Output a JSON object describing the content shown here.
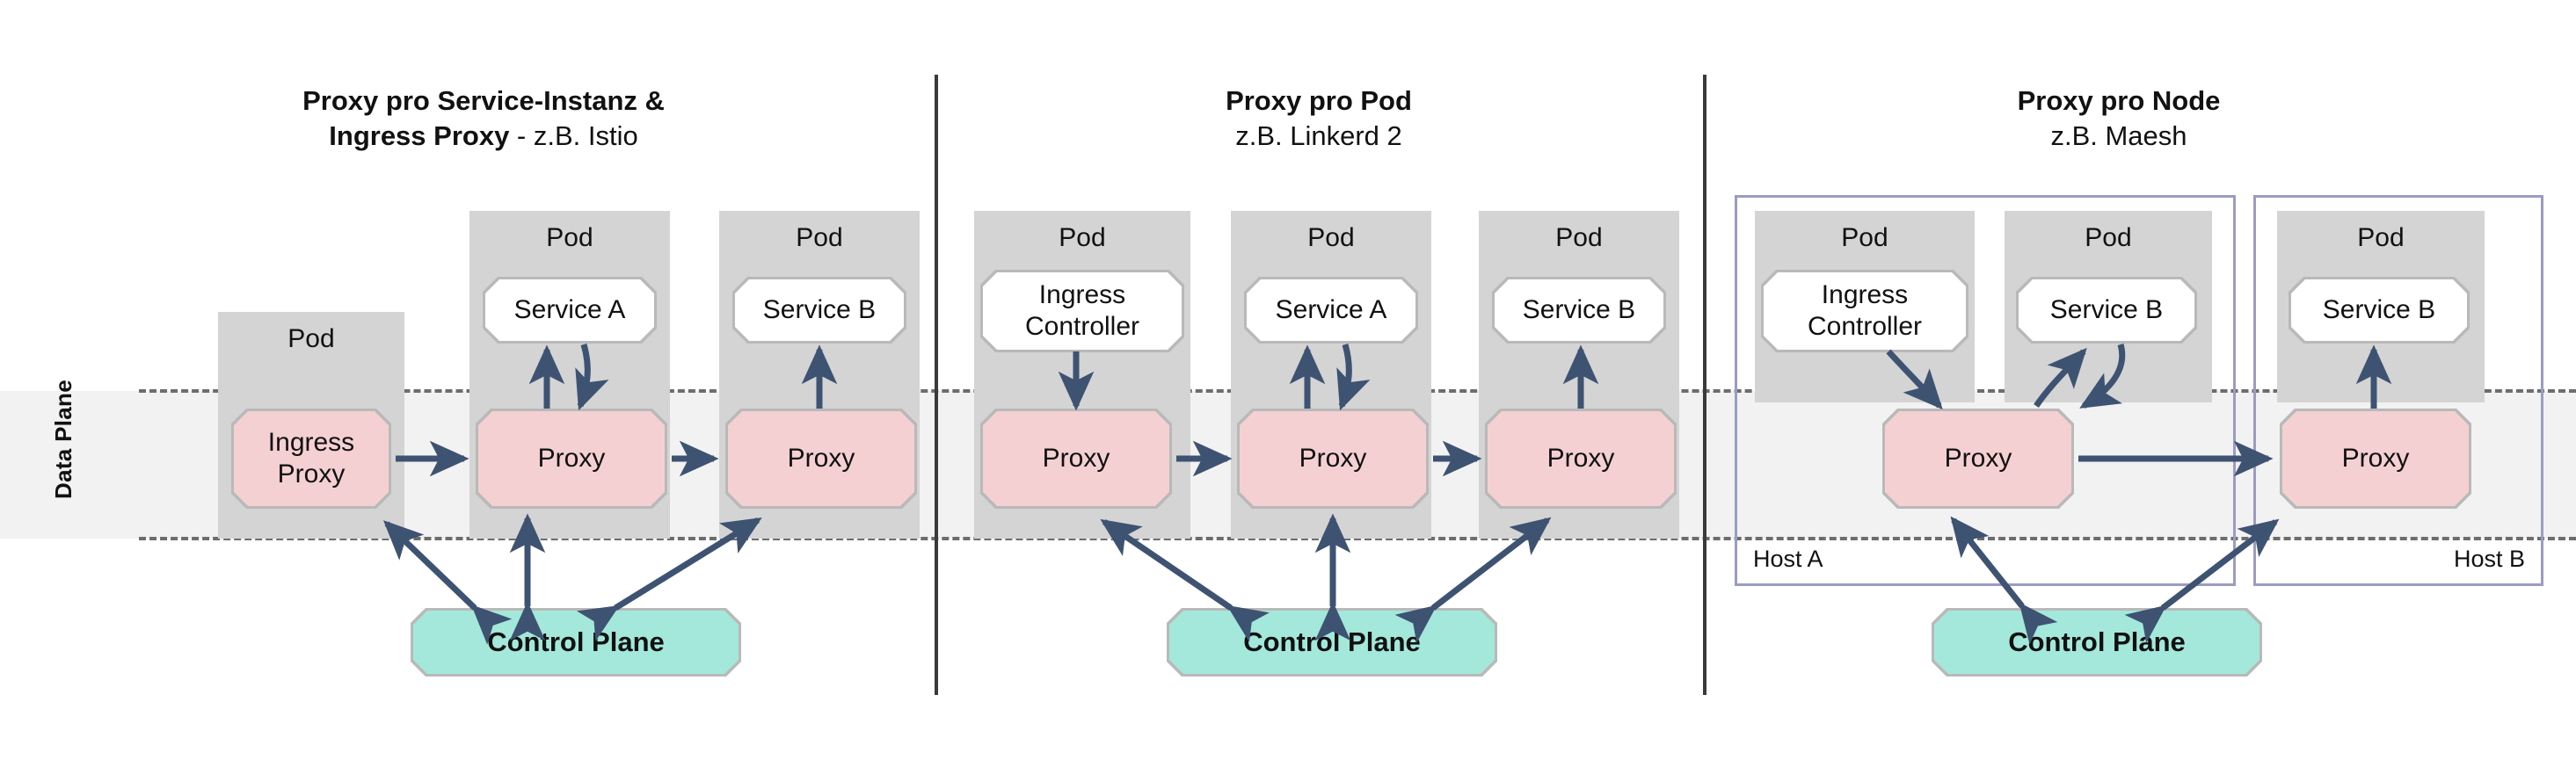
{
  "diagram": {
    "plane_label": "Data Plane",
    "panels": [
      {
        "title_bold": "Proxy pro Service-Instanz &\nIngress Proxy",
        "title_line1_bold": "Proxy pro Service-Instanz &",
        "title_line2_bold": "Ingress Proxy",
        "title_line2_regular": " - z.B. Istio",
        "pods": [
          {
            "pod_label": "Pod",
            "inner_label": null
          },
          {
            "pod_label": "Pod",
            "inner_label": "Service A"
          },
          {
            "pod_label": "Pod",
            "inner_label": "Service B"
          }
        ],
        "proxies": [
          {
            "label": "Ingress\nProxy",
            "line1": "Ingress",
            "line2": "Proxy"
          },
          {
            "label": "Proxy",
            "line1": "Proxy",
            "line2": ""
          },
          {
            "label": "Proxy",
            "line1": "Proxy",
            "line2": ""
          }
        ],
        "control_plane": "Control Plane"
      },
      {
        "title_line1_bold": "Proxy pro Pod",
        "title_line2_regular": "z.B. Linkerd 2",
        "pods": [
          {
            "pod_label": "Pod",
            "inner_label": "Ingress\nController",
            "line1": "Ingress",
            "line2": "Controller"
          },
          {
            "pod_label": "Pod",
            "inner_label": "Service A"
          },
          {
            "pod_label": "Pod",
            "inner_label": "Service B"
          }
        ],
        "proxies": [
          {
            "label": "Proxy"
          },
          {
            "label": "Proxy"
          },
          {
            "label": "Proxy"
          }
        ],
        "control_plane": "Control Plane"
      },
      {
        "title_line1_bold": "Proxy pro Node",
        "title_line2_regular": "z.B. Maesh",
        "hosts": [
          {
            "name": "Host A",
            "pods": [
              {
                "pod_label": "Pod",
                "inner_label": "Ingress\nController",
                "line1": "Ingress",
                "line2": "Controller"
              },
              {
                "pod_label": "Pod",
                "inner_label": "Service B"
              }
            ],
            "proxy": "Proxy"
          },
          {
            "name": "Host B",
            "pods": [
              {
                "pod_label": "Pod",
                "inner_label": "Service B"
              }
            ],
            "proxy": "Proxy"
          }
        ],
        "control_plane": "Control Plane"
      }
    ],
    "colors": {
      "pod_gray": "#d4d4d4",
      "proxy_pink": "#f4d0d2",
      "control_plane_teal": "#a4e8dc",
      "arrow_blue": "#3e5272",
      "plane_band": "#f2f2f2",
      "host_border": "#9b9bc4",
      "separator": "#3a3a3a"
    }
  }
}
